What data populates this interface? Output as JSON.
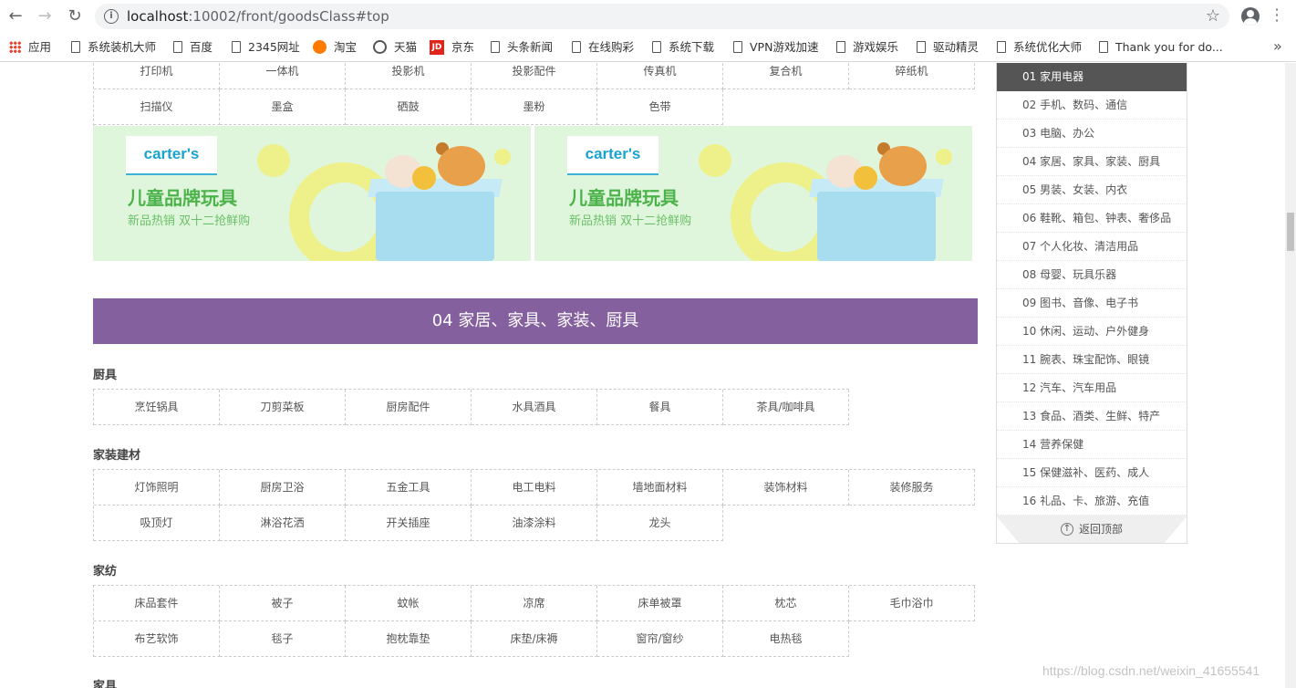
{
  "browser": {
    "url_host": "localhost",
    "url_rest": ":10002/front/goodsClass#top",
    "bookmarks": [
      {
        "label": "应用",
        "icon": "apps-grid-icon"
      },
      {
        "label": "系统装机大师",
        "icon": "page-icon"
      },
      {
        "label": "百度",
        "icon": "page-icon"
      },
      {
        "label": "2345网址",
        "icon": "page-icon"
      },
      {
        "label": "淘宝",
        "icon": "taobao-icon"
      },
      {
        "label": "天猫",
        "icon": "tmall-icon"
      },
      {
        "label": "京东",
        "icon": "jd-icon",
        "icon_text": "JD"
      },
      {
        "label": "头条新闻",
        "icon": "page-icon"
      },
      {
        "label": "在线购彩",
        "icon": "page-icon"
      },
      {
        "label": "系统下载",
        "icon": "page-icon"
      },
      {
        "label": "VPN游戏加速",
        "icon": "page-icon"
      },
      {
        "label": "游戏娱乐",
        "icon": "page-icon"
      },
      {
        "label": "驱动精灵",
        "icon": "page-icon"
      },
      {
        "label": "系统优化大师",
        "icon": "page-icon"
      },
      {
        "label": "Thank you for do...",
        "icon": "page-icon"
      }
    ]
  },
  "top_grid": {
    "row1": [
      "打印机",
      "一体机",
      "投影机",
      "投影配件",
      "传真机",
      "复合机",
      "碎纸机"
    ],
    "row2": [
      "扫描仪",
      "墨盒",
      "硒鼓",
      "墨粉",
      "色带"
    ]
  },
  "banners": [
    {
      "logo": "carter's",
      "title": "儿童品牌玩具",
      "subtitle": "新品热销 双十二抢鲜购"
    },
    {
      "logo": "carter's",
      "title": "儿童品牌玩具",
      "subtitle": "新品热销 双十二抢鲜购"
    }
  ],
  "category_header": "04 家居、家具、家装、厨具",
  "sections": [
    {
      "title": "厨具",
      "rows": [
        [
          "烹饪锅具",
          "刀剪菜板",
          "厨房配件",
          "水具酒具",
          "餐具",
          "茶具/咖啡具"
        ]
      ]
    },
    {
      "title": "家装建材",
      "rows": [
        [
          "灯饰照明",
          "厨房卫浴",
          "五金工具",
          "电工电料",
          "墙地面材料",
          "装饰材料",
          "装修服务"
        ],
        [
          "吸顶灯",
          "淋浴花洒",
          "开关插座",
          "油漆涂料",
          "龙头"
        ]
      ]
    },
    {
      "title": "家纺",
      "rows": [
        [
          "床品套件",
          "被子",
          "蚊帐",
          "凉席",
          "床单被罩",
          "枕芯",
          "毛巾浴巾"
        ],
        [
          "布艺软饰",
          "毯子",
          "抱枕靠垫",
          "床垫/床褥",
          "窗帘/窗纱",
          "电热毯"
        ]
      ]
    },
    {
      "title": "家具",
      "rows": []
    }
  ],
  "side_nav": {
    "items": [
      "01 家用电器",
      "02 手机、数码、通信",
      "03 电脑、办公",
      "04 家居、家具、家装、厨具",
      "05 男装、女装、内衣",
      "06 鞋靴、箱包、钟表、奢侈品",
      "07 个人化妆、清洁用品",
      "08 母婴、玩具乐器",
      "09 图书、音像、电子书",
      "10 休闲、运动、户外健身",
      "11 腕表、珠宝配饰、眼镜",
      "12 汽车、汽车用品",
      "13 食品、酒类、生鲜、特产",
      "14 营养保健",
      "15 保健滋补、医药、成人",
      "16 礼品、卡、旅游、充值"
    ],
    "active_index": 0,
    "back_to_top": "返回顶部"
  },
  "watermark": "https://blog.csdn.net/weixin_41655541",
  "colors": {
    "category_header": "#85609e",
    "side_active": "#555555",
    "banner_bg": "#dff6dc"
  }
}
